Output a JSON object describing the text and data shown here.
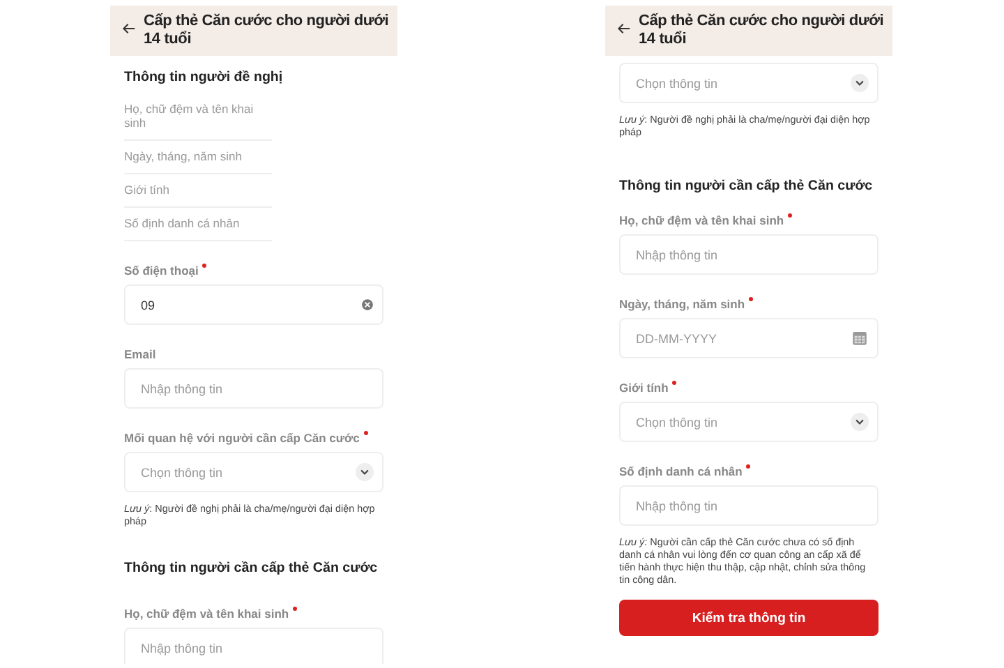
{
  "screens": [
    {
      "title": "Cấp thẻ Căn cước cho người dưới 14 tuổi",
      "blocks": [
        {
          "kind": "heading",
          "text": "Thông tin người đề nghị"
        },
        {
          "kind": "readonly",
          "text": "Họ, chữ đệm và tên khai sinh"
        },
        {
          "kind": "readonly",
          "text": "Ngày, tháng, năm sinh"
        },
        {
          "kind": "readonly",
          "text": "Giới tính"
        },
        {
          "kind": "readonly",
          "text": "Số định danh cá nhân"
        },
        {
          "kind": "clearable_field",
          "label": "Số điện thoại",
          "required": true,
          "value": "09"
        },
        {
          "kind": "text_field",
          "label": "Email",
          "placeholder": "Nhập thông tin"
        },
        {
          "kind": "select_field",
          "label": "Mối quan hệ với người cần cấp Căn cước",
          "required": true,
          "placeholder": "Chọn thông tin"
        },
        {
          "kind": "note",
          "text": "*Lưu ý*: Người đề nghị phải là cha/mẹ/người đại diện hợp pháp"
        },
        {
          "kind": "heading",
          "text": "Thông tin người cần cấp thẻ Căn cước"
        },
        {
          "kind": "text_field",
          "label": "Họ, chữ đệm và tên khai sinh",
          "required": true,
          "placeholder": "Nhập thông tin"
        }
      ]
    },
    {
      "title": "Cấp thẻ Căn cước cho người dưới 14 tuổi",
      "blocks": [
        {
          "kind": "select_field",
          "placeholder": "Chọn thông tin"
        },
        {
          "kind": "note",
          "text": "*Lưu ý*: Người đề nghị phải là cha/mẹ/người đại diện hợp pháp"
        },
        {
          "kind": "heading",
          "text": "Thông tin người cần cấp thẻ Căn cước"
        },
        {
          "kind": "text_field",
          "label": "Họ, chữ đệm và tên khai sinh",
          "required": true,
          "placeholder": "Nhập thông tin"
        },
        {
          "kind": "date_field",
          "label": "Ngày, tháng, năm sinh",
          "required": true,
          "placeholder": "DD-MM-YYYY"
        },
        {
          "kind": "select_field",
          "label": "Giới tính",
          "required": true,
          "placeholder": "Chọn thông tin"
        },
        {
          "kind": "text_field",
          "label": "Số định danh cá nhân",
          "required": true,
          "placeholder": "Nhập thông tin"
        },
        {
          "kind": "note",
          "text": "*Lưu ý:* Người cần cấp thẻ Căn cước chưa có số định danh cá nhân vui lòng đến cơ quan công an cấp xã để tiến hành thực hiện thu thập, cập nhật, chỉnh sửa thông tin công dân."
        },
        {
          "kind": "button",
          "text": "Kiểm tra thông tin"
        }
      ]
    }
  ]
}
